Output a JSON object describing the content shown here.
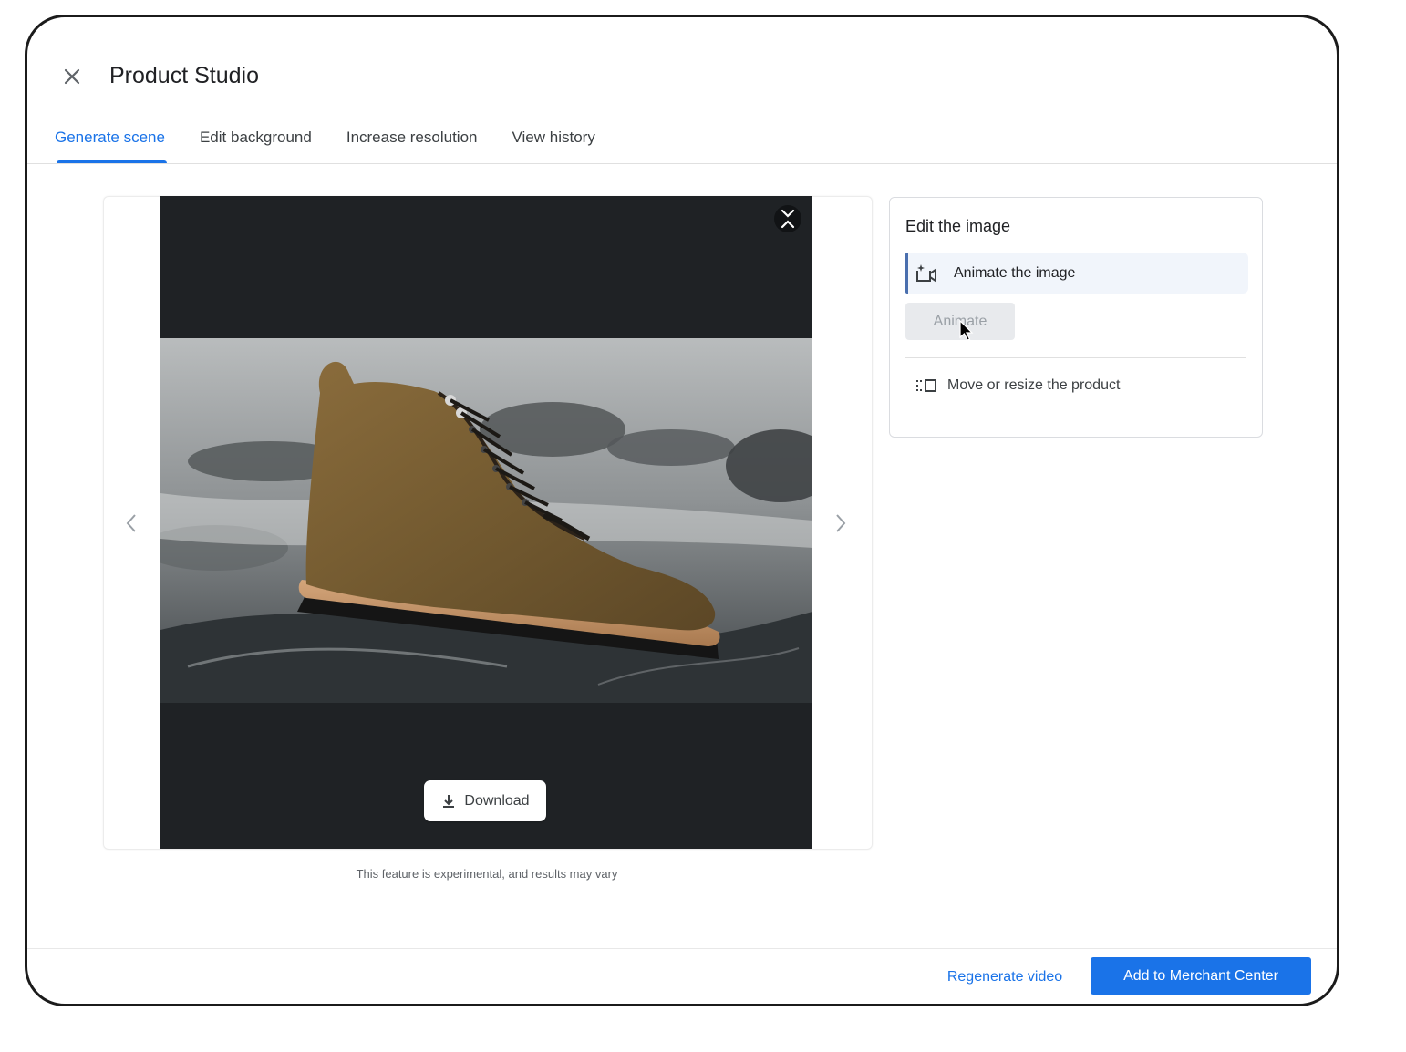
{
  "header": {
    "title": "Product Studio",
    "close_icon": "close-icon"
  },
  "tabs": [
    {
      "label": "Generate scene",
      "active": true
    },
    {
      "label": "Edit background",
      "active": false
    },
    {
      "label": "Increase resolution",
      "active": false
    },
    {
      "label": "View history",
      "active": false
    }
  ],
  "viewer": {
    "collapse_icon": "collapse-icon",
    "image_subject": "suede lace-up boot on wet rocks",
    "download_label": "Download",
    "prev_icon": "chevron-left-icon",
    "next_icon": "chevron-right-icon",
    "disclaimer": "This feature is experimental, and results may vary"
  },
  "edit_panel": {
    "title": "Edit the image",
    "animate_option_label": "Animate the image",
    "animate_option_icon": "animate-video-icon",
    "animate_button_label": "Animate",
    "animate_button_disabled": true,
    "move_option_label": "Move or resize the product",
    "move_option_icon": "move-resize-icon"
  },
  "footer": {
    "regenerate_label": "Regenerate video",
    "primary_label": "Add to Merchant Center"
  },
  "colors": {
    "accent": "#1a73e8",
    "viewer_bg": "#1f2225",
    "active_option_bg": "#f1f5fb"
  }
}
